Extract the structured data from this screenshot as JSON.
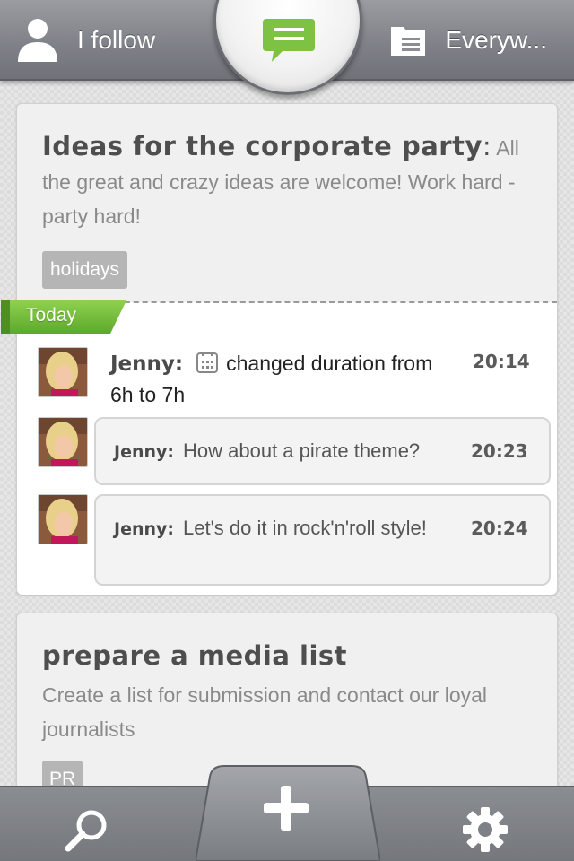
{
  "topbar": {
    "left_label": "I follow",
    "right_label": "Everyw...",
    "left_icon": "person-icon",
    "center_icon": "chat-bubble-icon",
    "right_icon": "list-icon",
    "accent_color": "#7dc242"
  },
  "task1": {
    "title": "Ideas for the corporate party",
    "separator": ":",
    "description": "All the great and crazy ideas are welcome! Work hard - party hard!",
    "tag": "holidays",
    "day_label": "Today",
    "activity": {
      "author": "Jenny:",
      "text": "changed duration from 6h to 7h",
      "time": "20:14",
      "icon": "calendar-icon"
    },
    "comments": [
      {
        "author": "Jenny:",
        "text": "How about a pirate theme?",
        "time": "20:23"
      },
      {
        "author": "Jenny:",
        "text": "Let's do it in rock'n'roll style!",
        "time": "20:24"
      }
    ]
  },
  "task2": {
    "title": "prepare a media list",
    "description": "Create a list for submission and contact our loyal journalists",
    "tag": "PR"
  },
  "bottombar": {
    "left_icon": "search-icon",
    "center_icon": "plus-icon",
    "right_icon": "gear-icon"
  }
}
